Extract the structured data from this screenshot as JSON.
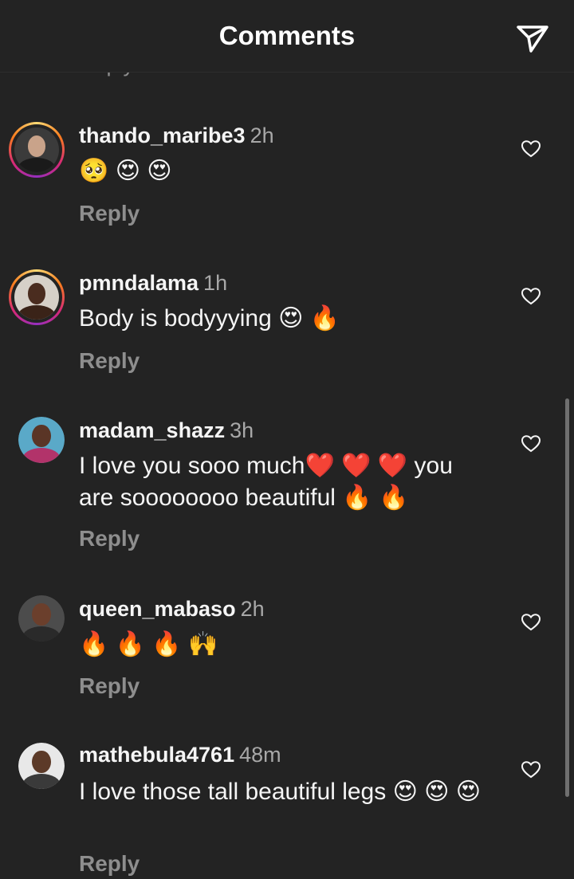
{
  "header": {
    "title": "Comments",
    "send_icon": "paper-plane-icon"
  },
  "cut_reply_label": "Reply",
  "colors": {
    "background": "#232323",
    "text": "#f5f5f5",
    "muted": "#8e8e8e"
  },
  "comments": [
    {
      "username": "thando_maribe3",
      "time": "2h",
      "text": "🥺 😍 😍",
      "reply_label": "Reply",
      "story_ring": true
    },
    {
      "username": "pmndalama",
      "time": "1h",
      "text": "Body is bodyyying 😍 🔥",
      "reply_label": "Reply",
      "story_ring": true
    },
    {
      "username": "madam_shazz",
      "time": "3h",
      "text": "I love you sooo much❤️ ❤️ ❤️  you are soooooooo beautiful 🔥 🔥",
      "reply_label": "Reply",
      "story_ring": false
    },
    {
      "username": "queen_mabaso",
      "time": "2h",
      "text": "🔥 🔥 🔥 🙌",
      "reply_label": "Reply",
      "story_ring": false
    },
    {
      "username": "mathebula4761",
      "time": "48m",
      "text": "I love those tall beautiful legs 😍 😍 😍",
      "reply_label": "Reply",
      "story_ring": false
    }
  ]
}
